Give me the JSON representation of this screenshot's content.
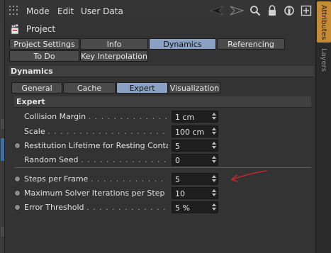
{
  "menubar": {
    "items": [
      "Mode",
      "Edit",
      "User Data"
    ]
  },
  "toolbar_icons": [
    "pointer-left-icon",
    "pointer-right-icon",
    "search-icon",
    "lock-icon",
    "settings-icon",
    "add-panel-icon"
  ],
  "object": {
    "name": "Project",
    "icon": "project-clapper-icon"
  },
  "main_tabs": {
    "row1": [
      "Project Settings",
      "Info",
      "Dynamics",
      "Referencing"
    ],
    "row2": [
      "To Do",
      "Key Interpolation"
    ],
    "active": "Dynamics"
  },
  "section_title": "Dynamics",
  "sub_tabs": {
    "items": [
      "General",
      "Cache",
      "Expert",
      "Visualization"
    ],
    "active": "Expert"
  },
  "group_title": "Expert",
  "params_a": [
    {
      "label": "Collision Margin",
      "value": "1 cm",
      "radio": false
    },
    {
      "label": "Scale",
      "value": "100 cm",
      "radio": false
    },
    {
      "label": "Restitution Lifetime for Resting Contact",
      "value": "5",
      "radio": true
    },
    {
      "label": "Random Seed",
      "value": "0",
      "radio": false
    }
  ],
  "params_b": [
    {
      "label": "Steps per Frame",
      "value": "5",
      "radio": true
    },
    {
      "label": "Maximum Solver Iterations per Step",
      "value": "10",
      "radio": true
    },
    {
      "label": "Error Threshold",
      "value": "5 %",
      "radio": true
    }
  ],
  "side_tabs": [
    "Attributes",
    "Layers"
  ],
  "colors": {
    "active_tab": "#8aa1c4",
    "side_tab_active": "#c88a33",
    "annotation_arrow": "#c0282a"
  }
}
